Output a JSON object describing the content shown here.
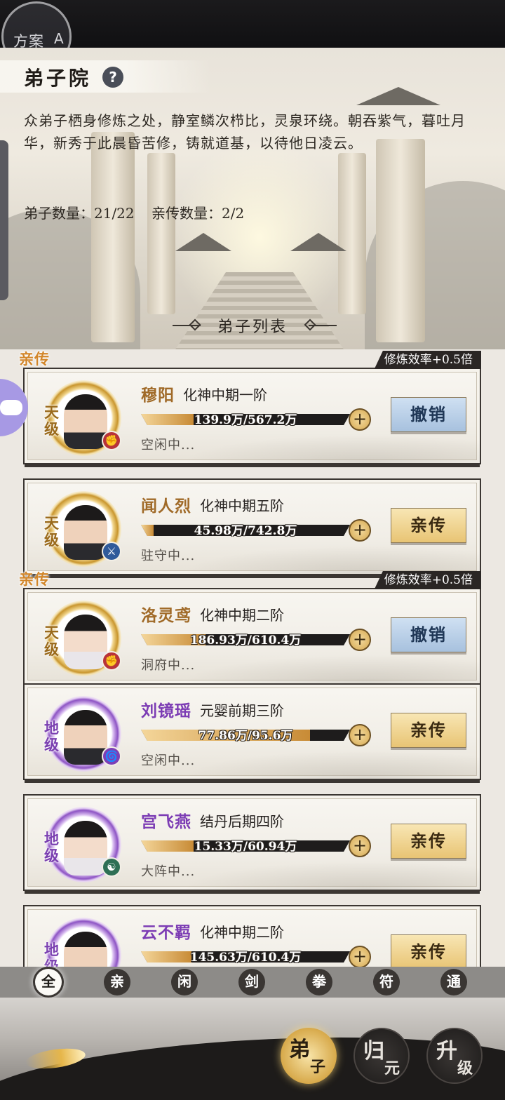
{
  "top": {
    "plan_label": "方案",
    "plan_letter": "A"
  },
  "header": {
    "title": "弟子院",
    "help": "?",
    "intro": "众弟子栖身修炼之处，静室鳞次栉比，灵泉环绕。朝吞紫气，暮吐月华，新秀于此晨昏苦修，铸就道基，以待他日凌云。",
    "disciple_count": "弟子数量：21/22",
    "direct_count": "亲传数量：2/2"
  },
  "list_title": "弟子列表",
  "disciples": [
    {
      "tag": "亲传",
      "bonus": "修炼效率+0.5倍",
      "grade": "天级",
      "name": "穆阳",
      "realm": "化神中期一阶",
      "progress_text": "139.9万/567.2万",
      "progress": 0.25,
      "state": "空闲中...",
      "action": "撤销",
      "plus": "+"
    },
    {
      "tag": "",
      "bonus": "",
      "grade": "天级",
      "name": "闻人烈",
      "realm": "化神中期五阶",
      "progress_text": "45.98万/742.8万",
      "progress": 0.06,
      "state": "驻守中...",
      "action": "亲传",
      "plus": "+"
    },
    {
      "tag": "亲传",
      "bonus": "修炼效率+0.5倍",
      "grade": "天级",
      "name": "洛灵鸢",
      "realm": "化神中期二阶",
      "progress_text": "186.93万/610.4万",
      "progress": 0.31,
      "state": "洞府中...",
      "action": "撤销",
      "plus": "+"
    },
    {
      "tag": "",
      "bonus": "",
      "grade": "地级",
      "name": "刘镜瑶",
      "realm": "元婴前期三阶",
      "progress_text": "77.86万/95.6万",
      "progress": 0.81,
      "state": "空闲中...",
      "action": "亲传",
      "plus": "+"
    },
    {
      "tag": "",
      "bonus": "",
      "grade": "地级",
      "name": "宫飞燕",
      "realm": "结丹后期四阶",
      "progress_text": "15.33万/60.94万",
      "progress": 0.25,
      "state": "大阵中...",
      "action": "亲传",
      "plus": "+"
    },
    {
      "tag": "",
      "bonus": "",
      "grade": "地级",
      "name": "云不羁",
      "realm": "化神中期二阶",
      "progress_text": "145.63万/610.4万",
      "progress": 0.24,
      "state": "",
      "action": "亲传",
      "plus": "+"
    }
  ],
  "filters": [
    "全",
    "亲",
    "闲",
    "剑",
    "拳",
    "符",
    "通"
  ],
  "nav": [
    {
      "big": "弟",
      "small": "子"
    },
    {
      "big": "归",
      "small": "元"
    },
    {
      "big": "升",
      "small": "级"
    }
  ],
  "colors": {
    "gold": "#c88b36",
    "purple": "#7c3cb4",
    "direct_tag": "#d2862a",
    "cancel_button": "#a7c1de",
    "direct_button": "#e8c474"
  }
}
